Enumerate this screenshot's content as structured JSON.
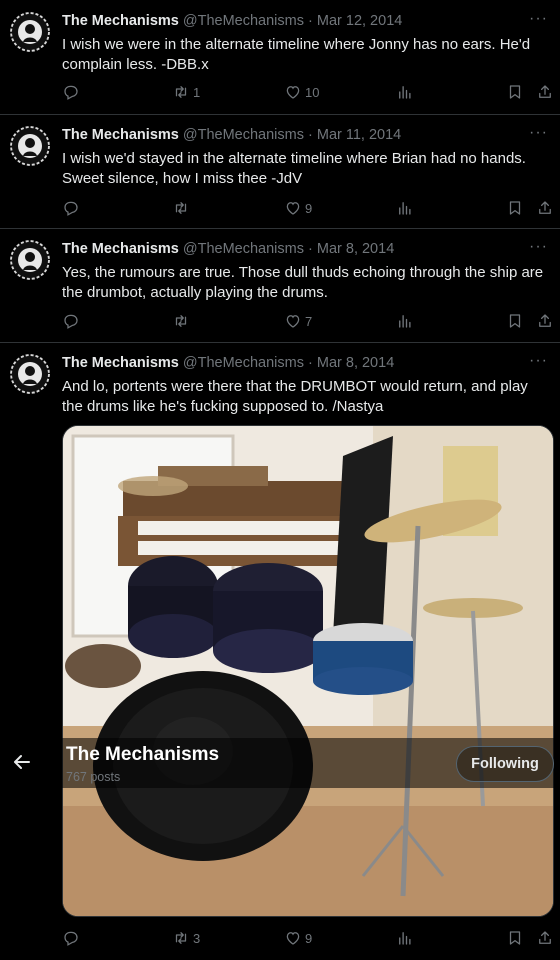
{
  "tweets": [
    {
      "name": "The Mechanisms",
      "handle": "@TheMechanisms",
      "dot": "·",
      "date": "Mar 12, 2014",
      "text": "I wish we were in the alternate timeline where Jonny has no ears. He'd complain less. -DBB.x",
      "retweets": "1",
      "likes": "10"
    },
    {
      "name": "The Mechanisms",
      "handle": "@TheMechanisms",
      "dot": "·",
      "date": "Mar 11, 2014",
      "text": "I wish we'd stayed in the alternate timeline where Brian had no hands. Sweet silence, how I miss thee -JdV",
      "retweets": "",
      "likes": "9"
    },
    {
      "name": "The Mechanisms",
      "handle": "@TheMechanisms",
      "dot": "·",
      "date": "Mar 8, 2014",
      "text": "Yes, the rumours are true. Those dull thuds echoing through the ship are the drumbot, actually playing the drums.",
      "retweets": "",
      "likes": "7"
    },
    {
      "name": "The Mechanisms",
      "handle": "@TheMechanisms",
      "dot": "·",
      "date": "Mar 8, 2014",
      "text": "And lo, portents were there that the DRUMBOT would return, and play the drums like he's fucking supposed to. /Nastya",
      "retweets": "3",
      "likes": "9"
    }
  ],
  "more_glyph": "···",
  "profile_header": {
    "name": "The Mechanisms",
    "posts": "767 posts",
    "follow_label": "Following"
  }
}
